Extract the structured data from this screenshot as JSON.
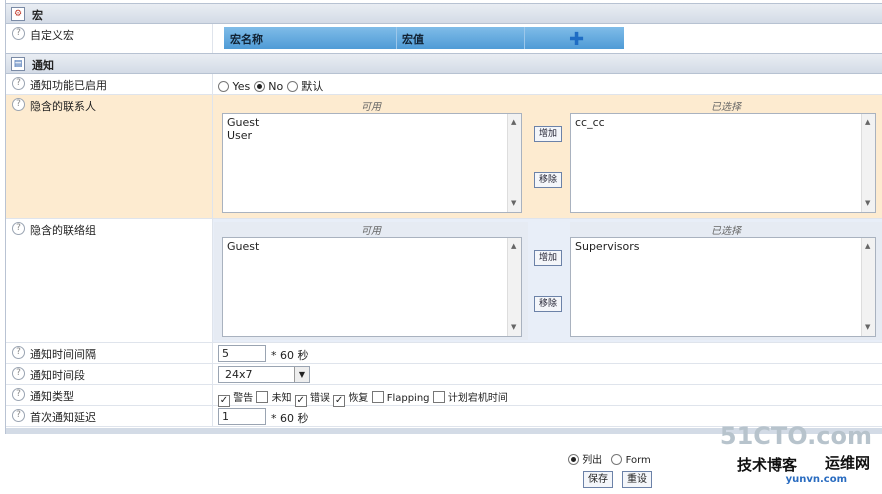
{
  "macro_section": {
    "title": "宏",
    "custom_macro_label": "自定义宏",
    "col_name": "宏名称",
    "col_value": "宏值"
  },
  "notify_section": {
    "title": "通知",
    "enabled": {
      "label": "通知功能已启用",
      "opt_yes": "Yes",
      "opt_no": "No",
      "opt_default": "默认",
      "selected": "No"
    },
    "contacts": {
      "label": "隐含的联系人",
      "available_caption": "可用",
      "selected_caption": "已选择",
      "available": [
        "Guest",
        "User"
      ],
      "selected": [
        "cc_cc"
      ],
      "add": "增加",
      "remove": "移除"
    },
    "contact_groups": {
      "label": "隐含的联络组",
      "available_caption": "可用",
      "selected_caption": "已选择",
      "available": [
        "Guest"
      ],
      "selected": [
        "Supervisors"
      ],
      "add": "增加",
      "remove": "移除"
    },
    "interval": {
      "label": "通知时间间隔",
      "value": "5",
      "suffix": "* 60 秒"
    },
    "period": {
      "label": "通知时间段",
      "value": "24x7"
    },
    "types": {
      "label": "通知类型",
      "options": [
        {
          "text": "警告",
          "checked": true
        },
        {
          "text": "未知",
          "checked": false
        },
        {
          "text": "错误",
          "checked": true
        },
        {
          "text": "恢复",
          "checked": true
        },
        {
          "text": "Flapping",
          "checked": false
        },
        {
          "text": "计划宕机时间",
          "checked": false
        }
      ]
    },
    "first_delay": {
      "label": "首次通知延迟",
      "value": "1",
      "suffix": "* 60 秒"
    }
  },
  "footer": {
    "opt_list": "列出",
    "opt_form": "Form",
    "save": "保存",
    "reset": "重设",
    "watermark1": "51CTO.com",
    "watermark2": "技术博客",
    "watermark3": "运维网",
    "watermark4": "yunvn.com"
  }
}
